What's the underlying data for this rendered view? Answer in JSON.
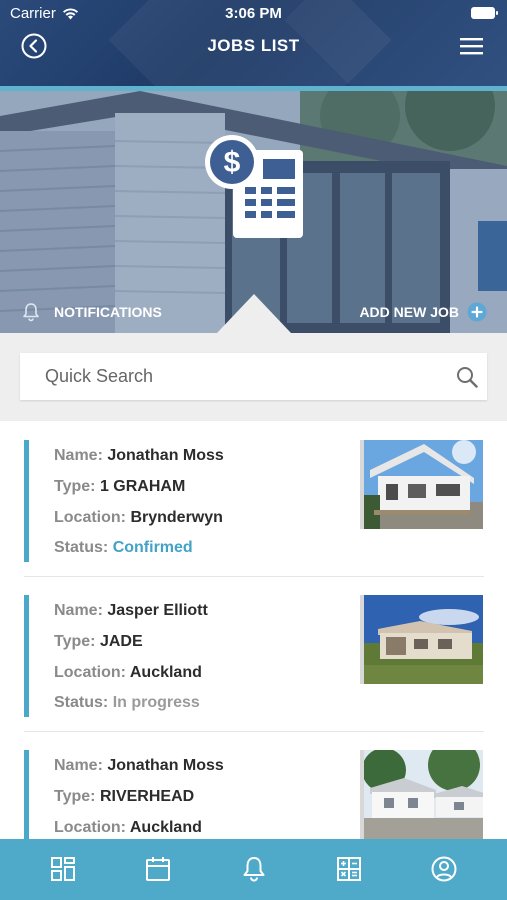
{
  "status_bar": {
    "carrier": "Carrier",
    "time": "3:06 PM"
  },
  "header": {
    "title": "JOBS LIST",
    "back_icon": "back-circle-icon",
    "menu_icon": "hamburger-menu-icon"
  },
  "hero": {
    "icon": "dollar-calculator-icon",
    "notifications_label": "NOTIFICATIONS",
    "add_job_label": "ADD NEW JOB"
  },
  "search": {
    "placeholder": "Quick Search",
    "value": ""
  },
  "field_labels": {
    "name": "Name:",
    "type": "Type:",
    "location": "Location:",
    "status": "Status:"
  },
  "jobs": [
    {
      "name": "Jonathan Moss",
      "type": "1 GRAHAM",
      "location": "Brynderwyn",
      "status": "Confirmed"
    },
    {
      "name": "Jasper Elliott",
      "type": "JADE",
      "location": "Auckland",
      "status": "In progress"
    },
    {
      "name": "Jonathan Moss",
      "type": "RIVERHEAD",
      "location": "Auckland",
      "status": ""
    }
  ],
  "tabbar": {
    "tabs": [
      "dashboard-icon",
      "calendar-icon",
      "bell-icon",
      "calculator-icon",
      "profile-icon"
    ]
  },
  "colors": {
    "header": "#1e3a66",
    "accent": "#4eaac8",
    "confirmed": "#42a3c7"
  }
}
